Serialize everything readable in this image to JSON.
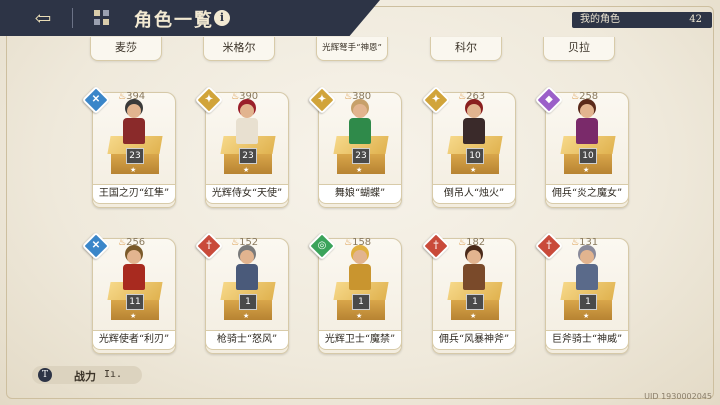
{
  "header": {
    "title": "角色一覧",
    "back_icon": "back-arrow-icon",
    "grid_icon": "grid-icon",
    "info_icon": "i"
  },
  "my_characters": {
    "label": "我的角色",
    "count": "42"
  },
  "tabs": [
    "麦莎",
    "米格尔",
    "光辉弩手“神恩”",
    "科尔",
    "贝拉"
  ],
  "cards": [
    {
      "name": "王国之刃“红隼”",
      "power": "394",
      "level": "23",
      "element_color": "#3a86c9",
      "element_glyph": "✕",
      "body": "#8a2a2a",
      "hair": "#3a3a3a"
    },
    {
      "name": "光辉侍女“天使”",
      "power": "390",
      "level": "23",
      "element_color": "#d1a43a",
      "element_glyph": "✦",
      "body": "#e8e0d0",
      "hair": "#9a1f2a"
    },
    {
      "name": "舞娘“蝴蝶”",
      "power": "380",
      "level": "23",
      "element_color": "#d1a43a",
      "element_glyph": "✦",
      "body": "#2f8a4a",
      "hair": "#c7a06a"
    },
    {
      "name": "倒吊人“烛火”",
      "power": "263",
      "level": "10",
      "element_color": "#d1a43a",
      "element_glyph": "✦",
      "body": "#3a2a2a",
      "hair": "#8a1f1f"
    },
    {
      "name": "佣兵“炎之魔女”",
      "power": "258",
      "level": "10",
      "element_color": "#9b5fc9",
      "element_glyph": "◆",
      "body": "#7a2a6a",
      "hair": "#5a2a1a"
    },
    {
      "name": "光辉使者“利刃”",
      "power": "256",
      "level": "11",
      "element_color": "#3a86c9",
      "element_glyph": "✕",
      "body": "#a82a1f",
      "hair": "#7a5a2a"
    },
    {
      "name": "枪骑士“怒风”",
      "power": "152",
      "level": "1",
      "element_color": "#c94a3a",
      "element_glyph": "†",
      "body": "#4a5a7a",
      "hair": "#7a7a7a"
    },
    {
      "name": "光辉卫士“魔禁”",
      "power": "158",
      "level": "1",
      "element_color": "#3aa35a",
      "element_glyph": "◎",
      "body": "#c9952f",
      "hair": "#e0b040"
    },
    {
      "name": "佣兵“风暴神斧”",
      "power": "182",
      "level": "1",
      "element_color": "#c94a3a",
      "element_glyph": "†",
      "body": "#7a4a2a",
      "hair": "#4a2a1a"
    },
    {
      "name": "巨斧骑士“神威”",
      "power": "131",
      "level": "1",
      "element_color": "#c94a3a",
      "element_glyph": "†",
      "body": "#5a6a8a",
      "hair": "#8a8a9a"
    }
  ],
  "footer": {
    "power_label": "战力",
    "power_icon": "T",
    "sort_icon": "Iı.",
    "uid": "UID 1930002045"
  }
}
